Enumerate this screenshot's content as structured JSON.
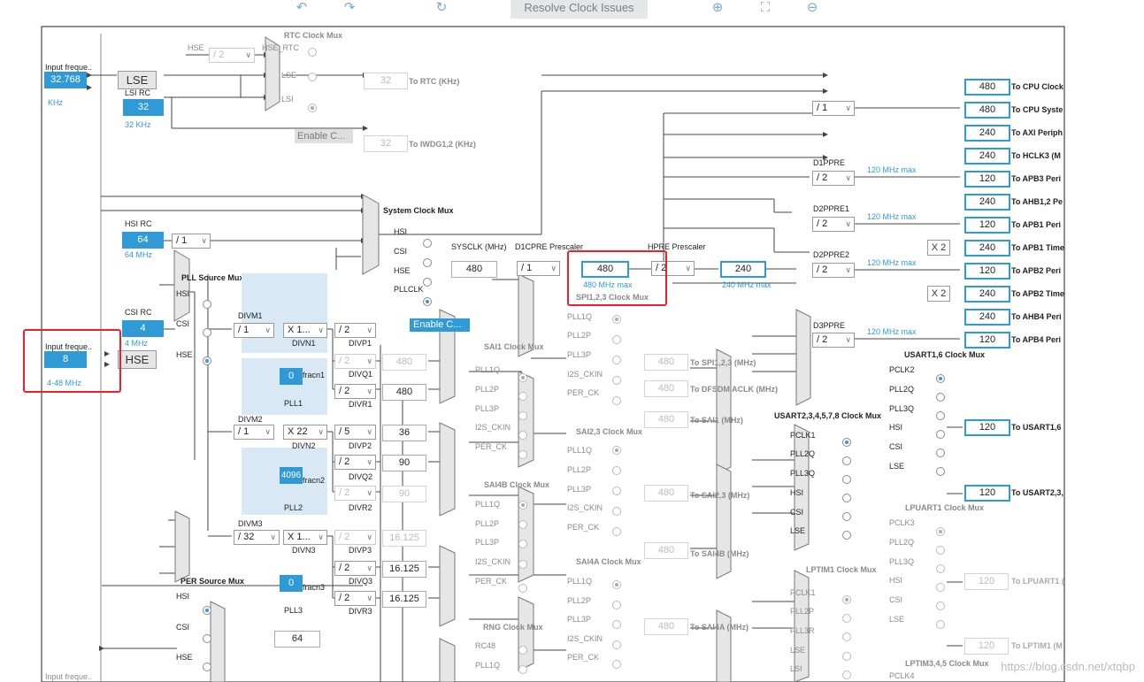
{
  "toolbar": {
    "undo_icon": "undo-icon",
    "redo_icon": "redo-icon",
    "refresh_icon": "refresh-icon",
    "resolve_label": "Resolve Clock Issues",
    "zoom_in_icon": "zoom-in-icon",
    "fit_icon": "fit-screen-icon",
    "zoom_out_icon": "zoom-out-icon"
  },
  "left": {
    "lse_input_label": "Input freque..",
    "lse_input_value": "32.768",
    "lse_unit": "KHz",
    "lse_button": "LSE",
    "lsi_label": "LSI RC",
    "lsi_value": "32",
    "lsi_unit": "32 KHz",
    "hsi_label": "HSI RC",
    "hsi_value": "64",
    "hsi_unit": "64 MHz",
    "hsi_div": "/ 1",
    "csi_label": "CSI RC",
    "csi_value": "4",
    "csi_unit": "4 MHz",
    "hse_input_label": "Input freque..",
    "hse_input_value": "8",
    "hse_range": "4-48 MHz",
    "hse_button": "HSE",
    "bottom_input_label": "Input freque.."
  },
  "rtc": {
    "title": "RTC Clock Mux",
    "hse_label": "HSE",
    "hse_div": "/ 2",
    "in_hse_rtc": "HSE_RTC",
    "in_lse": "LSE",
    "in_lsi": "LSI",
    "rtc_value": "32",
    "rtc_label": "To RTC (KHz)",
    "enable_css": "Enable C...",
    "iwdg_value": "32",
    "iwdg_label": "To IWDG1,2 (KHz)"
  },
  "sysmux": {
    "title": "System Clock Mux",
    "in_hsi": "HSI",
    "in_csi": "CSI",
    "in_hse": "HSE",
    "in_pllclk": "PLLCLK",
    "enable_css": "Enable C..."
  },
  "pll": {
    "source_title": "PLL Source Mux",
    "in_hsi": "HSI",
    "in_csi": "CSI",
    "in_hse": "HSE",
    "divm1_label": "DIVM1",
    "divm1": "/ 1",
    "divn1": "X 1...",
    "divn1_label": "DIVN1",
    "divp1": "/ 2",
    "divp1_label": "DIVP1",
    "divq1": "/ 2",
    "divq1_label": "DIVQ1",
    "divq1_value": "480",
    "divr1": "/ 2",
    "divr1_label": "DIVR1",
    "divr1_value": "480",
    "fracn1_value": "0",
    "fracn1_label": "fracn1",
    "pll1_label": "PLL1",
    "divm2_label": "DIVM2",
    "divm2": "/ 1",
    "divn2": "X 22",
    "divn2_label": "DIVN2",
    "divp2": "/ 5",
    "divp2_label": "DIVP2",
    "divp2_value": "36",
    "divq2": "/ 2",
    "divq2_label": "DIVQ2",
    "divq2_value": "90",
    "divr2": "/ 2",
    "divr2_label": "DIVR2",
    "divr2_value": "90",
    "fracn2_value": "4096",
    "fracn2_label": "fracn2",
    "pll2_label": "PLL2",
    "divm3_label": "DIVM3",
    "divm3": "/ 32",
    "divn3": "X 1...",
    "divn3_label": "DIVN3",
    "divp3": "/ 2",
    "divp3_label": "DIVP3",
    "divp3_value": "16.125",
    "divq3": "/ 2",
    "divq3_label": "DIVQ3",
    "divq3_value": "16.125",
    "divr3": "/ 2",
    "divr3_label": "DIVR3",
    "divr3_value": "16.125",
    "fracn3_value": "0",
    "fracn3_label": "fracn3",
    "pll3_label": "PLL3"
  },
  "per": {
    "title": "PER Source Mux",
    "in_hsi": "HSI",
    "in_csi": "CSI",
    "in_hse": "HSE",
    "value": "64"
  },
  "sys": {
    "sysclk_label": "SYSCLK (MHz)",
    "sysclk_value": "480",
    "d1cpre_label": "D1CPRE Prescaler",
    "d1cpre": "/ 1",
    "hclk_value": "480",
    "hclk_max": "480 MHz max",
    "hpre_label": "HPRE Prescaler",
    "hpre": "/ 2",
    "ahb_value": "240",
    "ahb_max": "240 MHz max"
  },
  "apb": {
    "cpu_div": "/ 1",
    "d1ppre_label": "D1PPRE",
    "d1ppre": "/ 2",
    "d1ppre_max": "120 MHz max",
    "d2ppre1_label": "D2PPRE1",
    "d2ppre1": "/ 2",
    "d2ppre1_max": "120 MHz max",
    "d2ppre2_label": "D2PPRE2",
    "d2ppre2": "/ 2",
    "d2ppre2_max": "120 MHz max",
    "d3ppre_label": "D3PPRE",
    "d3ppre": "/ 2",
    "d3ppre_max": "120 MHz max",
    "x2a": "X 2",
    "x2b": "X 2"
  },
  "outputs": [
    {
      "value": "480",
      "label": "To CPU Clock"
    },
    {
      "value": "480",
      "label": "To CPU Syste"
    },
    {
      "value": "240",
      "label": "To AXI Periph"
    },
    {
      "value": "240",
      "label": "To HCLK3 (M"
    },
    {
      "value": "120",
      "label": "To APB3 Peri"
    },
    {
      "value": "240",
      "label": "To AHB1,2 Pe"
    },
    {
      "value": "120",
      "label": "To APB1 Peri"
    },
    {
      "value": "240",
      "label": "To APB1 Time"
    },
    {
      "value": "120",
      "label": "To APB2 Peri"
    },
    {
      "value": "240",
      "label": "To APB2 Time"
    },
    {
      "value": "240",
      "label": "To AHB4 Peri"
    },
    {
      "value": "120",
      "label": "To APB4 Peri"
    }
  ],
  "spi": {
    "title": "SPI1,2,3 Clock Mux",
    "inputs": [
      "PLL1Q",
      "PLL2P",
      "PLL3P",
      "I2S_CKIN",
      "PER_CK"
    ],
    "value": "480",
    "label": "To SPI1,2,3 (MHz)"
  },
  "dfsdm": {
    "value": "480",
    "label": "To DFSDM ACLK (MHz)"
  },
  "sai1": {
    "title": "SAI1 Clock Mux",
    "inputs": [
      "PLL1Q",
      "PLL2P",
      "PLL3P",
      "I2S_CKIN",
      "PER_CK"
    ],
    "value": "480",
    "label": "To SAI1 (MHz)"
  },
  "sai23": {
    "title": "SAI2,3 Clock Mux",
    "inputs": [
      "PLL1Q",
      "PLL2P",
      "PLL3P",
      "I2S_CKIN",
      "PER_CK"
    ],
    "value": "480",
    "label": "To SAI2,3 (MHz)"
  },
  "sai4b": {
    "title": "SAI4B Clock Mux",
    "inputs": [
      "PLL1Q",
      "PLL2P",
      "PLL3P",
      "I2S_CKIN",
      "PER_CK"
    ],
    "value": "480",
    "label": "To SAI4B (MHz)"
  },
  "sai4a": {
    "title": "SAI4A Clock Mux",
    "inputs": [
      "PLL1Q",
      "PLL2P",
      "PLL3P",
      "I2S_CKIN",
      "PER_CK"
    ],
    "value": "480",
    "label": "To SAI4A (MHz)"
  },
  "rng": {
    "title": "RNG Clock Mux",
    "inputs": [
      "RC48",
      "PLL1Q"
    ]
  },
  "usart16": {
    "title": "USART1,6 Clock Mux",
    "inputs": [
      "PCLK2",
      "PLL2Q",
      "PLL3Q",
      "HSI",
      "CSI",
      "LSE"
    ],
    "value": "120",
    "label": "To USART1,6"
  },
  "usart2": {
    "title": "USART2,3,4,5,7,8 Clock Mux",
    "inputs": [
      "PCLK1",
      "PLL2Q",
      "PLL3Q",
      "HSI",
      "CSI",
      "LSE"
    ],
    "value": "120",
    "label": "To USART2,3,"
  },
  "lpuart": {
    "title": "LPUART1 Clock Mux",
    "inputs": [
      "PCLK3",
      "PLL2Q",
      "PLL3Q",
      "HSI",
      "CSI",
      "LSE"
    ],
    "value": "120",
    "label": "To LPUART1 ("
  },
  "lptim1": {
    "title": "LPTIM1 Clock Mux",
    "inputs": [
      "PCLK1",
      "PLL2P",
      "PLL3R",
      "LSE",
      "LSI"
    ],
    "value": "120",
    "label": "To LPTIM1 (M"
  },
  "lptim345": {
    "title": "LPTIM3,4,5 Clock Mux",
    "inputs": [
      "PCLK4"
    ]
  },
  "watermark": "https://blog.csdn.net/xtqbp",
  "colors": {
    "accent": "#2f9ad6",
    "highlight": "#e8242a",
    "zone": "#d8e8f4"
  }
}
